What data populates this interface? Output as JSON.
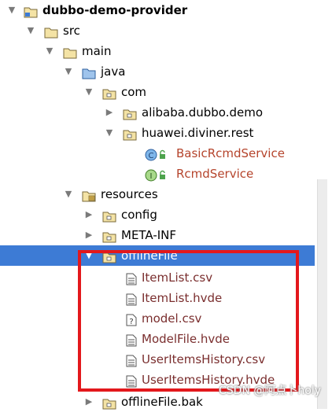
{
  "tree": {
    "items": [
      {
        "label": "dubbo-demo-provider",
        "icon": "module-folder-icon",
        "arrow": "▼"
      },
      {
        "label": "src",
        "icon": "folder-icon",
        "arrow": "▼"
      },
      {
        "label": "main",
        "icon": "folder-icon",
        "arrow": "▼"
      },
      {
        "label": "java",
        "icon": "source-folder-icon",
        "arrow": "▼"
      },
      {
        "label": "com",
        "icon": "package-icon",
        "arrow": "▼"
      },
      {
        "label": "alibaba.dubbo.demo",
        "icon": "package-icon",
        "arrow": "▶"
      },
      {
        "label": "huawei.diviner.rest",
        "icon": "package-icon",
        "arrow": "▼"
      },
      {
        "label": "BasicRcmdService",
        "icon": "class-icon",
        "arrow": ""
      },
      {
        "label": "RcmdService",
        "icon": "interface-icon",
        "arrow": ""
      },
      {
        "label": "resources",
        "icon": "resources-folder-icon",
        "arrow": "▼"
      },
      {
        "label": "config",
        "icon": "package-icon",
        "arrow": "▶"
      },
      {
        "label": "META-INF",
        "icon": "package-icon",
        "arrow": "▶"
      },
      {
        "label": "offlineFile",
        "icon": "package-icon",
        "arrow": "▼"
      },
      {
        "label": "ItemList.csv",
        "icon": "text-file-icon",
        "arrow": ""
      },
      {
        "label": "ItemList.hvde",
        "icon": "text-file-icon",
        "arrow": ""
      },
      {
        "label": "model.csv",
        "icon": "unknown-file-icon",
        "arrow": ""
      },
      {
        "label": "ModelFile.hvde",
        "icon": "text-file-icon",
        "arrow": ""
      },
      {
        "label": "UserItemsHistory.csv",
        "icon": "text-file-icon",
        "arrow": ""
      },
      {
        "label": "UserItemsHistory.hvde",
        "icon": "text-file-icon",
        "arrow": ""
      },
      {
        "label": "offlineFile.bak",
        "icon": "package-icon",
        "arrow": "▶"
      }
    ],
    "selected_index": 12
  },
  "watermark": "CSDN @阿点卜holy",
  "colors": {
    "selection": "#3d7bd5",
    "highlight_border": "#e3181c",
    "class_label": "#b5442c",
    "file_label": "#7a2e2e"
  }
}
